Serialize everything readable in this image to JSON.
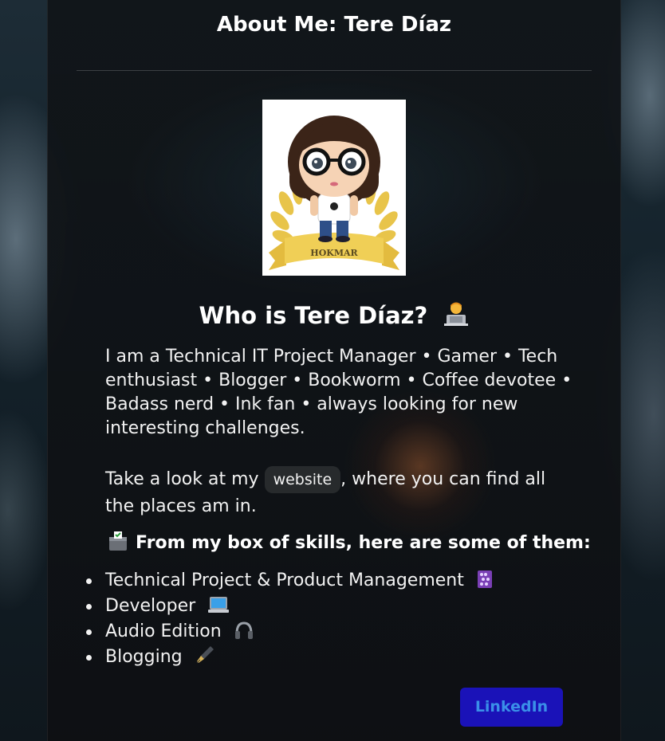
{
  "header": {
    "title": "About Me: Tere Díaz"
  },
  "avatar": {
    "banner_text": "HOKMAR"
  },
  "section": {
    "title": "Who is Tere Díaz?",
    "title_icon": "technologist-emoji"
  },
  "intro": {
    "text": "I am a Technical IT Project Manager • Gamer • Tech enthusiast • Blogger • Bookworm • Coffee devotee • Badass nerd • Ink fan • always looking for new interesting challenges.",
    "prefix": "Take a look at my",
    "link_label": "website",
    "suffix": ", where you can find all the places am in."
  },
  "skills": {
    "heading": "From my box of skills, here are some of them:",
    "heading_icon": "ballot-box-icon",
    "items": [
      {
        "label": "Technical Project & Product Management",
        "icon": "abacus-icon"
      },
      {
        "label": "Developer",
        "icon": "laptop-icon"
      },
      {
        "label": "Audio Edition",
        "icon": "headphones-icon"
      },
      {
        "label": "Blogging",
        "icon": "fountain-pen-icon"
      }
    ]
  },
  "linkedin": {
    "label": "LinkedIn"
  },
  "colors": {
    "button_bg": "#1a12b8",
    "button_text": "#3a8fe8",
    "page_text": "#f2f2f2"
  }
}
